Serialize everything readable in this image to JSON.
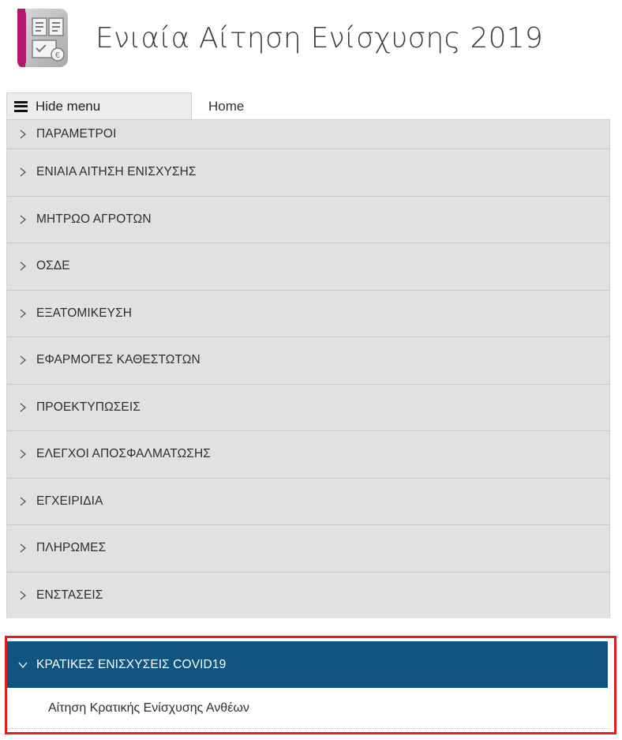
{
  "app": {
    "title": "Ενιαία Αίτηση Ενίσχυσης 2019",
    "logo_icon": "documents-euro-icon"
  },
  "tabs": {
    "hide_menu_label": "Hide menu",
    "home_label": "Home"
  },
  "menu": {
    "items": [
      {
        "label": "ΠΑΡΑΜΕΤΡΟΙ",
        "key": "parametroi"
      },
      {
        "label": "ΕΝΙΑΙΑ ΑΙΤΗΣΗ ΕΝΙΣΧΥΣΗΣ",
        "key": "eniaia-aitisi"
      },
      {
        "label": "ΜΗΤΡΩΟ ΑΓΡΟΤΩΝ",
        "key": "mitroo-agroton"
      },
      {
        "label": "ΟΣΔΕ",
        "key": "osde"
      },
      {
        "label": "ΕΞΑΤΟΜΙΚΕΥΣΗ",
        "key": "exatomikefsi"
      },
      {
        "label": "ΕΦΑΡΜΟΓΕΣ ΚΑΘΕΣΤΩΤΩΝ",
        "key": "efarmoges"
      },
      {
        "label": "ΠΡΟΕΚΤΥΠΩΣΕΙΣ",
        "key": "proektyposeis"
      },
      {
        "label": "ΕΛΕΓΧΟΙ ΑΠΟΣΦΑΛΜΑΤΩΣΗΣ",
        "key": "elegxoi"
      },
      {
        "label": "ΕΓΧΕΙΡΙΔΙΑ",
        "key": "egxeiridia"
      },
      {
        "label": "ΠΛΗΡΩΜΕΣ",
        "key": "pliromes"
      },
      {
        "label": "ΕΝΣΤΑΣΕΙΣ",
        "key": "enstaseis"
      }
    ],
    "expanded": {
      "label": "ΚΡΑΤΙΚΕΣ ΕΝΙΣΧΥΣΕΙΣ COVID19",
      "subitems": [
        {
          "label": "Αίτηση Κρατικής Ενίσχυσης Ανθέων"
        }
      ]
    }
  },
  "colors": {
    "menu_bg": "#e1e1e1",
    "active_bg": "#0f5580",
    "highlight_border": "#e02020",
    "logo_magenta": "#b5176e"
  }
}
